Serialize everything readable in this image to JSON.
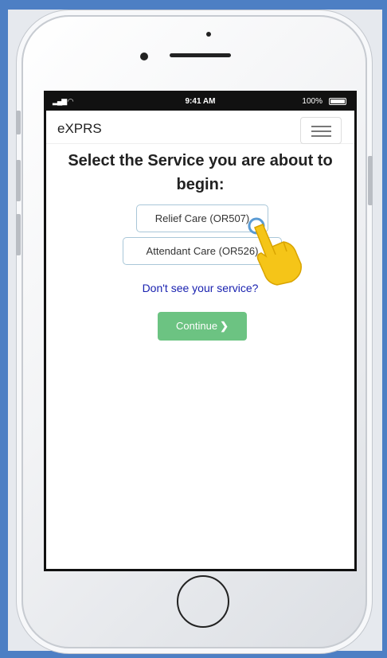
{
  "statusbar": {
    "time": "9:41 AM",
    "battery": "100%"
  },
  "navbar": {
    "brand": "eXPRS"
  },
  "main": {
    "heading": "Select the Service you are about to begin:",
    "services": [
      {
        "label": "Relief Care (OR507)"
      },
      {
        "label": "Attendant Care (OR526)"
      }
    ],
    "dont_see_link": "Don't see your service?",
    "continue_label": "Continue"
  },
  "colors": {
    "accent_green": "#6cc382",
    "link_blue": "#1a22b0",
    "slide_border": "#4d7fc4"
  },
  "icons": [
    "signal-icon",
    "wifi-icon",
    "battery-icon",
    "hamburger-menu-icon",
    "chevron-right-icon",
    "pointing-hand-icon"
  ]
}
